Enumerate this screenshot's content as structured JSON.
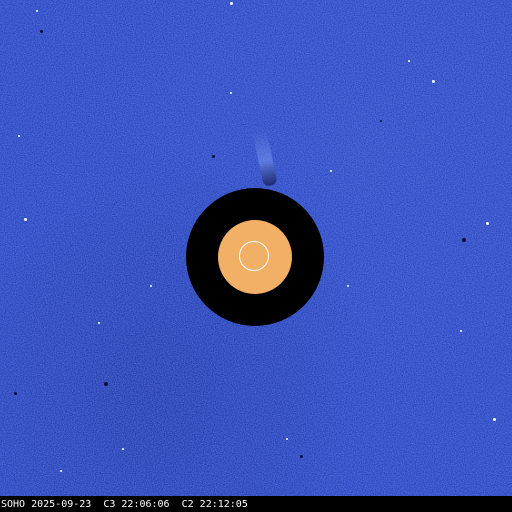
{
  "image": {
    "colors": {
      "background_field": "#1e3dbf",
      "occulter": "#000000",
      "inner_disk": "#f2b066",
      "sun_outline": "#ffffff",
      "caption_text": "#ffffff",
      "caption_bar": "#000000"
    }
  },
  "caption": {
    "text": "SOHO 2025-09-23  C3 22:06:06  C2 22:12:05"
  }
}
